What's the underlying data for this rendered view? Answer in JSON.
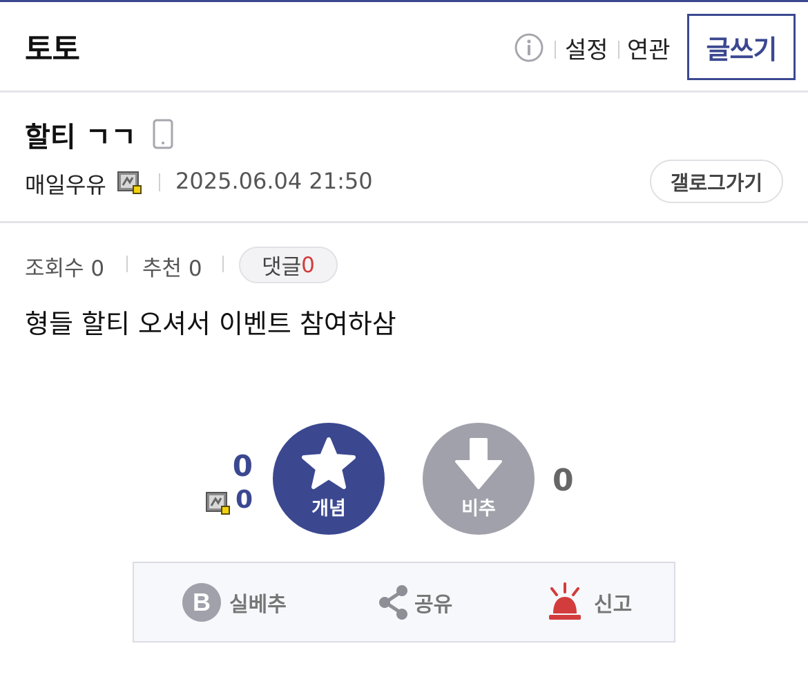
{
  "header": {
    "gallery_title": "토토",
    "settings_label": "설정",
    "related_label": "연관",
    "write_label": "글쓰기"
  },
  "post": {
    "title": "할티 ㄱㄱ",
    "author": "매일우유",
    "date": "2025.06.04 21:50",
    "gallog_label": "갤로그가기",
    "views_label": "조회수",
    "views": "0",
    "recommends_label": "추천",
    "recommends": "0",
    "comments_label": "댓글",
    "comments": "0",
    "body": "형들 할티 오셔서 이벤트 참여하삼"
  },
  "vote": {
    "recommend_count": "0",
    "fixed_recommend_count": "0",
    "recommend_label": "개념",
    "nonrecommend_label": "비추",
    "nonrecommend_count": "0"
  },
  "actions": {
    "best_label": "실베추",
    "share_label": "공유",
    "report_label": "신고",
    "best_icon_letter": "B"
  },
  "colors": {
    "accent": "#3b4890",
    "gray_circle": "#a1a1ab",
    "alert_red": "#d23c3c"
  },
  "icons": [
    "info-icon",
    "mobile-icon",
    "member-icon",
    "star-icon",
    "arrow-down-icon",
    "best-b-icon",
    "share-icon",
    "siren-icon"
  ]
}
